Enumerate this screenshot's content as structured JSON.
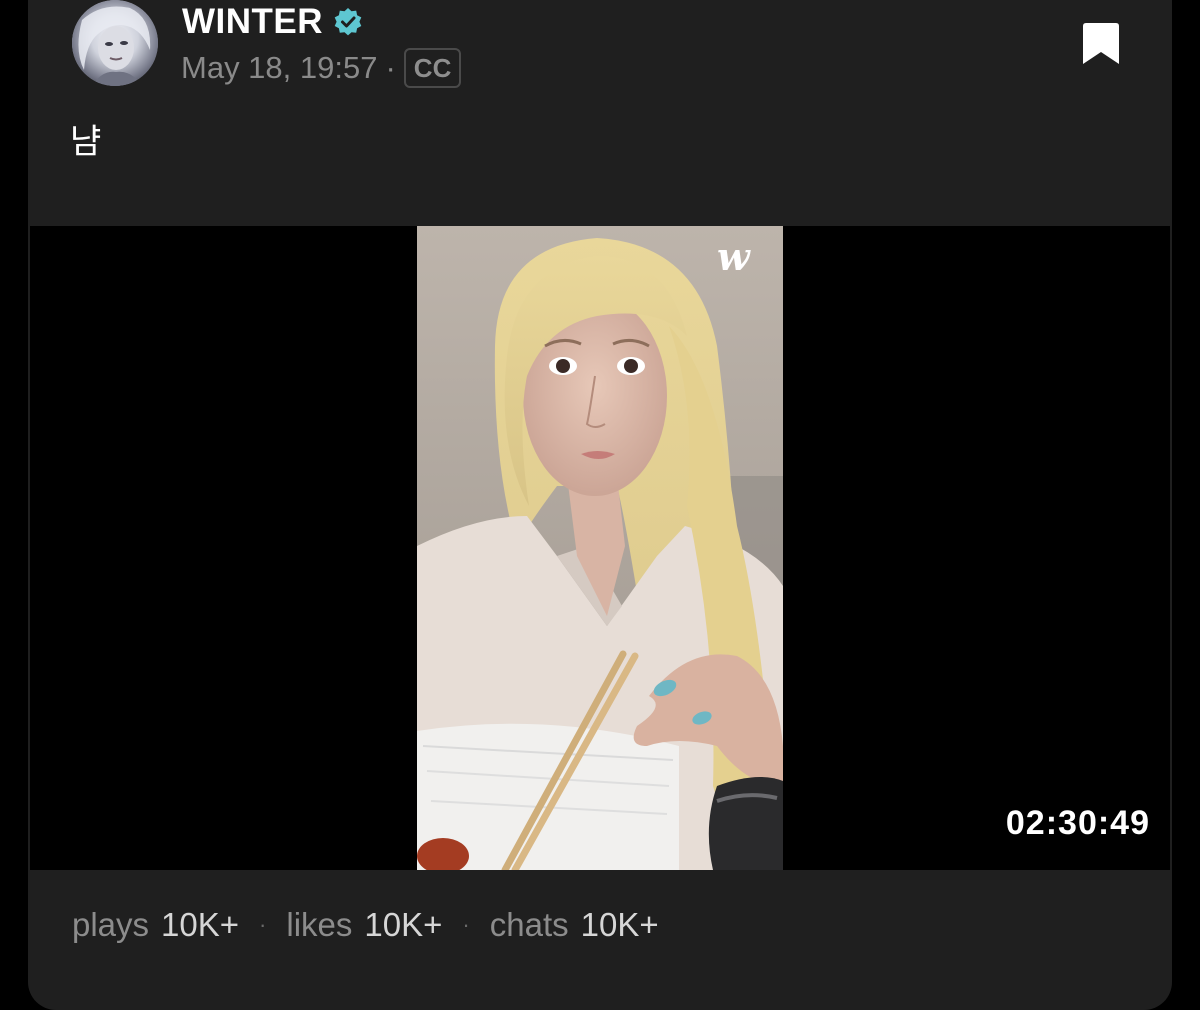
{
  "post": {
    "author": "WINTER",
    "verified": true,
    "date": "May 18, 19:57",
    "separator": "·",
    "cc_badge": "CC",
    "text": "냠"
  },
  "video": {
    "watermark": "w",
    "duration": "02:30:49"
  },
  "stats": [
    {
      "label": "plays",
      "value": "10K+"
    },
    {
      "label": "likes",
      "value": "10K+"
    },
    {
      "label": "chats",
      "value": "10K+"
    }
  ],
  "stat_separator": "·",
  "colors": {
    "card_bg": "#1f1f1f",
    "page_bg": "#000000",
    "verified_badge": "#5ec7d1",
    "muted_text": "#8a8a8a"
  },
  "icons": [
    "verified-badge-icon",
    "bookmark-icon",
    "cc-icon"
  ]
}
